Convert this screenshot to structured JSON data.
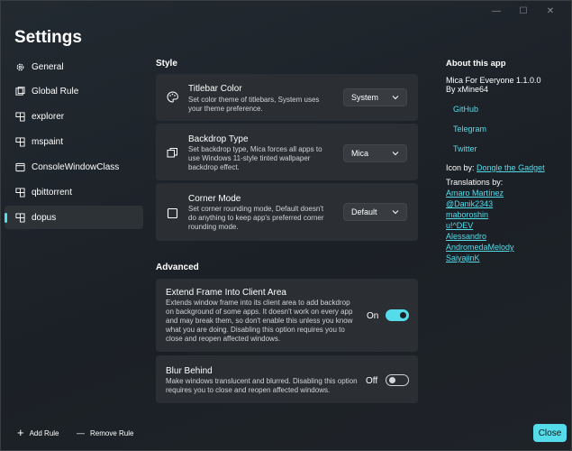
{
  "window": {
    "caption": {
      "minimize": "—",
      "maximize": "☐",
      "close": "✕"
    }
  },
  "title": "Settings",
  "nav": {
    "items": [
      {
        "label": "General",
        "icon": "gear-icon",
        "active": false
      },
      {
        "label": "Global Rule",
        "icon": "global-rule-icon",
        "active": false
      },
      {
        "label": "explorer",
        "icon": "app-icon",
        "active": false
      },
      {
        "label": "mspaint",
        "icon": "app-icon",
        "active": false
      },
      {
        "label": "ConsoleWindowClass",
        "icon": "window-icon",
        "active": false
      },
      {
        "label": "qbittorrent",
        "icon": "app-icon",
        "active": false
      },
      {
        "label": "dopus",
        "icon": "app-icon",
        "active": true
      }
    ]
  },
  "style": {
    "heading": "Style",
    "titlebar": {
      "title": "Titlebar Color",
      "desc": "Set color theme of titlebars, System uses your theme preference.",
      "value": "System",
      "icon": "palette-icon"
    },
    "backdrop": {
      "title": "Backdrop Type",
      "desc": "Set backdrop type, Mica forces all apps to use Windows 11-style tinted wallpaper backdrop effect.",
      "value": "Mica",
      "icon": "backdrop-icon"
    },
    "corner": {
      "title": "Corner Mode",
      "desc": "Set corner rounding mode, Default doesn't do anything to keep app's preferred corner rounding mode.",
      "value": "Default",
      "icon": "square-icon"
    }
  },
  "advanced": {
    "heading": "Advanced",
    "extend": {
      "title": "Extend Frame Into Client Area",
      "desc": "Extends window frame into its client area to add backdrop on background of some apps. It doesn't work on every app and may break them, so don't enable this unless you know what you are doing. Disabling this option requires you to close and reopen affected windows.",
      "state_label": "On",
      "on": true
    },
    "blur": {
      "title": "Blur Behind",
      "desc": "Make windows translucent and blurred. Disabling this option requires you to close and reopen affected windows.",
      "state_label": "Off",
      "on": false
    }
  },
  "about": {
    "heading": "About this app",
    "version": "Mica For Everyone 1.1.0.0",
    "author": "By xMine64",
    "links": [
      "GitHub",
      "Telegram",
      "Twitter"
    ],
    "icon_by_prefix": "Icon by: ",
    "icon_by_name": "Dongle the Gadget",
    "translations_heading": "Translations by:",
    "translators": [
      "Amaro Martínez",
      "@Danik2343",
      "maboroshin",
      "u!^DEV",
      "Alessandro",
      "AndromedaMelody",
      "SaiyajinK"
    ]
  },
  "footer": {
    "add_rule": "Add Rule",
    "add_symbol": "+",
    "remove_rule": "Remove Rule",
    "remove_symbol": "—",
    "close": "Close"
  },
  "colors": {
    "accent": "#54dceb",
    "card": "#2b2f33",
    "background": "#1e2226"
  }
}
